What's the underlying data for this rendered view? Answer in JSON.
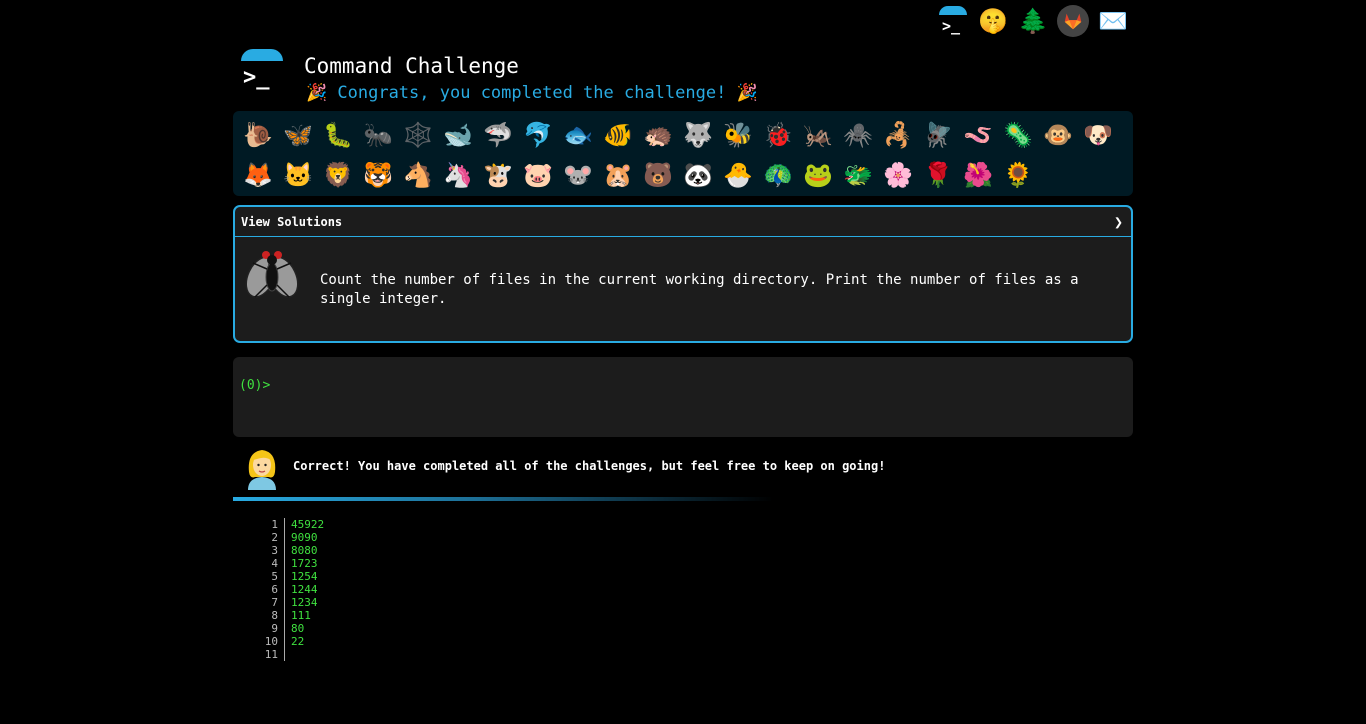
{
  "app": {
    "title": "Command Challenge",
    "subtitle": "🎉 Congrats, you completed the challenge! 🎉"
  },
  "topnav": {
    "items": [
      {
        "name": "terminal-logo-icon",
        "glyph": ">_"
      },
      {
        "name": "shush-face-icon",
        "glyph": "🤫"
      },
      {
        "name": "tree-icon",
        "glyph": "🌲"
      },
      {
        "name": "gitlab-icon",
        "glyph": ""
      },
      {
        "name": "envelope-icon",
        "glyph": "✉️"
      }
    ]
  },
  "creatures": [
    "🐌",
    "🦋",
    "🐛",
    "🐜",
    "🕸️",
    "🐋",
    "🦈",
    "🐬",
    "🐟",
    "🐠",
    "🦔",
    "🐺",
    "🐝",
    "🐞",
    "🦗",
    "🕷️",
    "🦂",
    "🪰",
    "🪱",
    "🦠",
    "🐵",
    "🐶",
    "🦊",
    "🐱",
    "🦁",
    "🐯",
    "🐴",
    "🦄",
    "🐮",
    "🐷",
    "🐭",
    "🐹",
    "🐻",
    "🐼",
    "🐣",
    "🦚",
    "🐸",
    "🐲",
    "🌸",
    "🌹",
    "🌺",
    "🌻"
  ],
  "panel": {
    "header_label": "View Solutions",
    "chevron": "❯",
    "challenge_text": "Count the number of files in the current working directory. Print the number of files as a single integer."
  },
  "terminal": {
    "prompt": "(0)>",
    "input_value": ""
  },
  "result": {
    "message": "Correct! You have completed all of the challenges, but feel free to keep on going!"
  },
  "output": {
    "lines": [
      {
        "n": "1",
        "v": "45922"
      },
      {
        "n": "2",
        "v": "9090"
      },
      {
        "n": "3",
        "v": "8080"
      },
      {
        "n": "4",
        "v": "1723"
      },
      {
        "n": "5",
        "v": "1254"
      },
      {
        "n": "6",
        "v": "1244"
      },
      {
        "n": "7",
        "v": "1234"
      },
      {
        "n": "8",
        "v": "111"
      },
      {
        "n": "9",
        "v": "80"
      },
      {
        "n": "10",
        "v": "22"
      },
      {
        "n": "11",
        "v": ""
      }
    ]
  },
  "colors": {
    "accent": "#29abe2",
    "prompt_green": "#3fe03f",
    "panel_bg": "#1c1c1c",
    "creature_bg": "#001a24"
  }
}
